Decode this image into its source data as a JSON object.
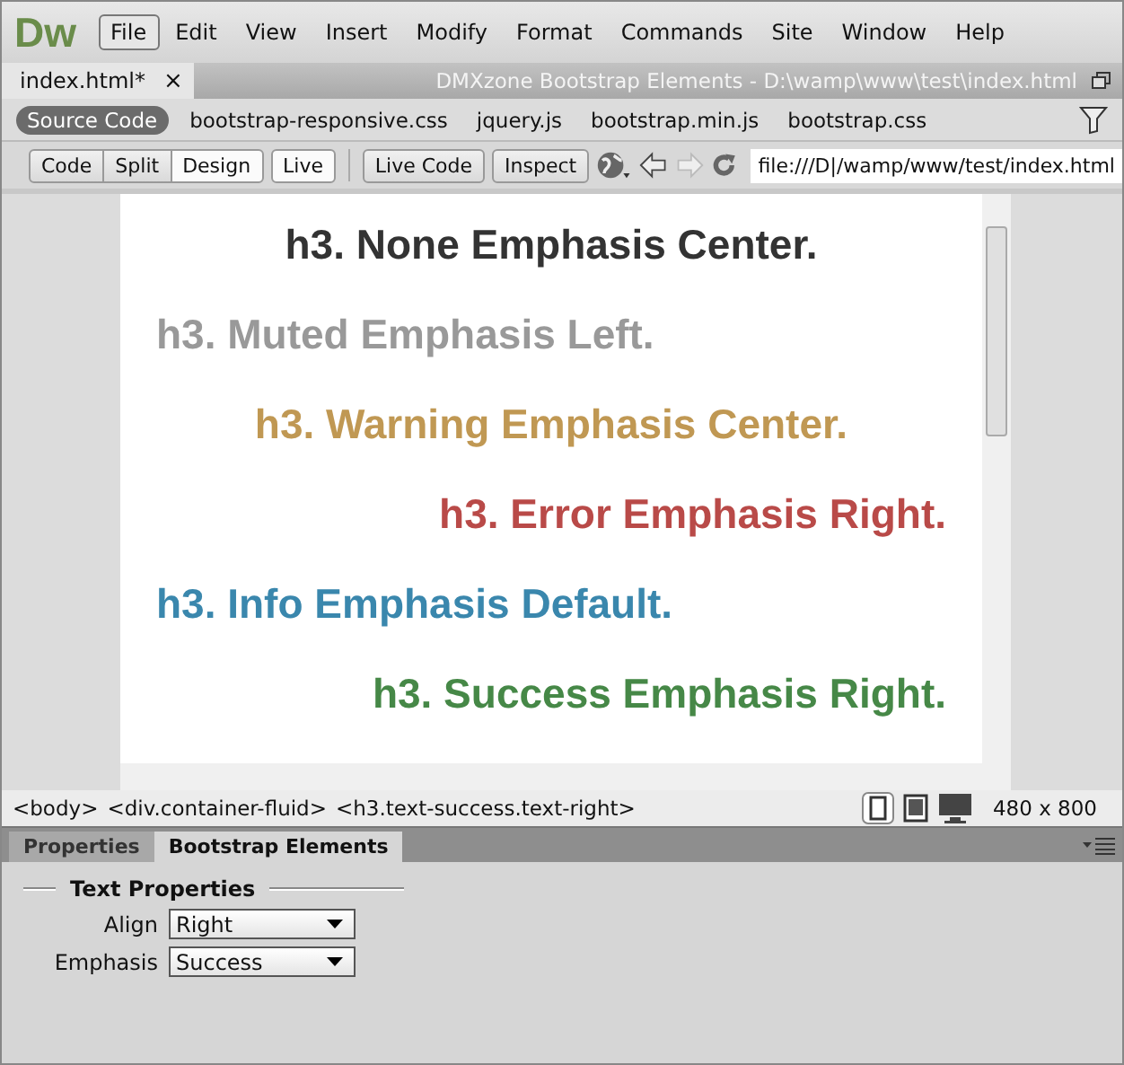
{
  "app": {
    "logo": "Dw"
  },
  "menu": [
    {
      "label": "File",
      "selected": true
    },
    {
      "label": "Edit",
      "selected": false
    },
    {
      "label": "View",
      "selected": false
    },
    {
      "label": "Insert",
      "selected": false
    },
    {
      "label": "Modify",
      "selected": false
    },
    {
      "label": "Format",
      "selected": false
    },
    {
      "label": "Commands",
      "selected": false
    },
    {
      "label": "Site",
      "selected": false
    },
    {
      "label": "Window",
      "selected": false
    },
    {
      "label": "Help",
      "selected": false
    }
  ],
  "document_tab": {
    "label": "index.html*",
    "close": "×"
  },
  "window": {
    "title": "DMXzone Bootstrap Elements - D:\\wamp\\www\\test\\index.html"
  },
  "related_files": [
    {
      "label": "Source Code",
      "selected": true
    },
    {
      "label": "bootstrap-responsive.css",
      "selected": false
    },
    {
      "label": "jquery.js",
      "selected": false
    },
    {
      "label": "bootstrap.min.js",
      "selected": false
    },
    {
      "label": "bootstrap.css",
      "selected": false
    }
  ],
  "view_modes": [
    {
      "label": "Code",
      "selected": false
    },
    {
      "label": "Split",
      "selected": false
    },
    {
      "label": "Design",
      "selected": true
    }
  ],
  "toolbar_buttons": [
    "Live",
    "Live Code",
    "Inspect"
  ],
  "address": {
    "value": "file:///D|/wamp/www/test/index.html"
  },
  "headings": [
    {
      "text": "h3. None Emphasis Center.",
      "kind": "none",
      "centered": true,
      "right_aligned": false
    },
    {
      "text": "h3. Muted Emphasis Left.",
      "kind": "muted",
      "centered": false,
      "right_aligned": false
    },
    {
      "text": "h3. Warning Emphasis Center.",
      "kind": "warning",
      "centered": true,
      "right_aligned": false
    },
    {
      "text": "h3. Error Emphasis Right.",
      "kind": "error",
      "centered": false,
      "right_aligned": true
    },
    {
      "text": "h3. Info Emphasis Default.",
      "kind": "info",
      "centered": false,
      "right_aligned": false
    },
    {
      "text": "h3. Success Emphasis Right.",
      "kind": "success",
      "centered": false,
      "right_aligned": true
    }
  ],
  "status_bar": {
    "tags": [
      "<body>",
      "<div.container-fluid>",
      "<h3.text-success.text-right>"
    ],
    "window_size": "480 x 800"
  },
  "panel": {
    "tabs": [
      {
        "label": "Properties",
        "selected": false
      },
      {
        "label": "Bootstrap Elements",
        "selected": true
      }
    ],
    "section": "Text Properties",
    "fields": [
      {
        "label": "Align",
        "value": "Right"
      },
      {
        "label": "Emphasis",
        "value": "Success"
      }
    ]
  }
}
